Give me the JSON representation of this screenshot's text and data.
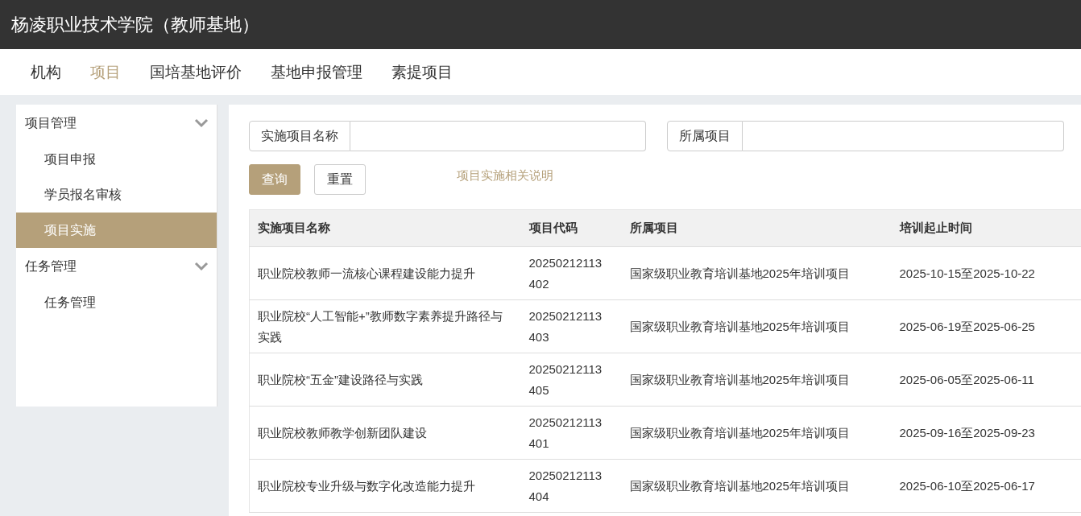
{
  "header": {
    "title": "杨凌职业技术学院（教师基地）"
  },
  "nav": [
    {
      "label": "机构",
      "selected": false
    },
    {
      "label": "项目",
      "selected": true
    },
    {
      "label": "国培基地评价",
      "selected": false
    },
    {
      "label": "基地申报管理",
      "selected": false
    },
    {
      "label": "素提项目",
      "selected": false
    }
  ],
  "sidebar": {
    "groups": [
      {
        "label": "项目管理",
        "expanded": true,
        "items": [
          {
            "label": "项目申报",
            "selected": false
          },
          {
            "label": "学员报名审核",
            "selected": false
          },
          {
            "label": "项目实施",
            "selected": true
          }
        ]
      },
      {
        "label": "任务管理",
        "expanded": true,
        "items": [
          {
            "label": "任务管理",
            "selected": false
          }
        ]
      }
    ]
  },
  "filters": [
    {
      "label": "实施项目名称"
    },
    {
      "label": "所属项目"
    }
  ],
  "buttons": [
    {
      "label": "查询",
      "kind": "primary"
    },
    {
      "label": "重置",
      "kind": "default"
    }
  ],
  "help_link": "项目实施相关说明",
  "table": {
    "columns": [
      "实施项目名称",
      "项目代码",
      "所属项目",
      "培训起止时间"
    ],
    "rows": [
      [
        "职业院校教师一流核心课程建设能力提升",
        "20250212113402",
        "国家级职业教育培训基地2025年培训项目",
        "2025-10-15至2025-10-22"
      ],
      [
        "职业院校“人工智能+”教师数字素养提升路径与实践",
        "20250212113403",
        "国家级职业教育培训基地2025年培训项目",
        "2025-06-19至2025-06-25"
      ],
      [
        "职业院校“五金”建设路径与实践",
        "20250212113405",
        "国家级职业教育培训基地2025年培训项目",
        "2025-06-05至2025-06-11"
      ],
      [
        "职业院校教师教学创新团队建设",
        "20250212113401",
        "国家级职业教育培训基地2025年培训项目",
        "2025-09-16至2025-09-23"
      ],
      [
        "职业院校专业升级与数字化改造能力提升",
        "20250212113404",
        "国家级职业教育培训基地2025年培训项目",
        "2025-06-10至2025-06-17"
      ]
    ]
  }
}
